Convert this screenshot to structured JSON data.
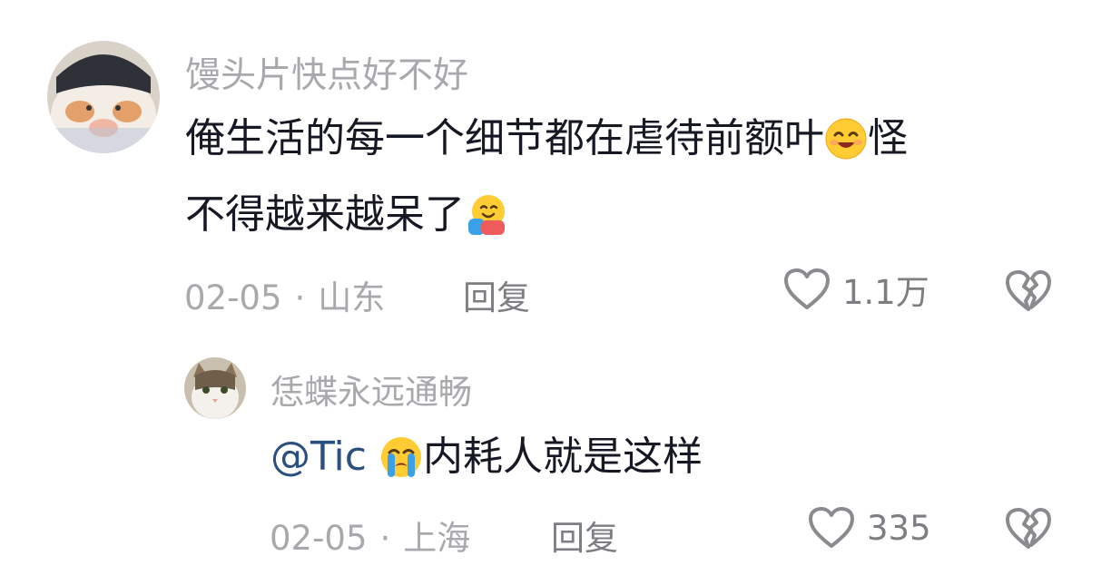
{
  "comments": [
    {
      "username": "馒头片快点好不好",
      "text_part1": "俺生活的每一个细节都在虐待前额叶",
      "emoji1": "smiling-face-icon",
      "text_part2": "怪",
      "text_part3": "不得越来越呆了",
      "emoji2": "hugging-face-icon",
      "date": "02-05",
      "location": "山东",
      "separator": "·",
      "reply_label": "回复",
      "like_count": "1.1万"
    },
    {
      "username": "恁蝶永远通畅",
      "mention": "@Tic",
      "emoji1": "crying-face-icon",
      "text": "内耗人就是这样",
      "date": "02-05",
      "location": "上海",
      "separator": "·",
      "reply_label": "回复",
      "like_count": "335"
    }
  ],
  "colors": {
    "username": "#a9a9ad",
    "text": "#161823",
    "mention": "#2b4f7e",
    "meta": "#a9a9ad",
    "action": "#7d7d82"
  }
}
